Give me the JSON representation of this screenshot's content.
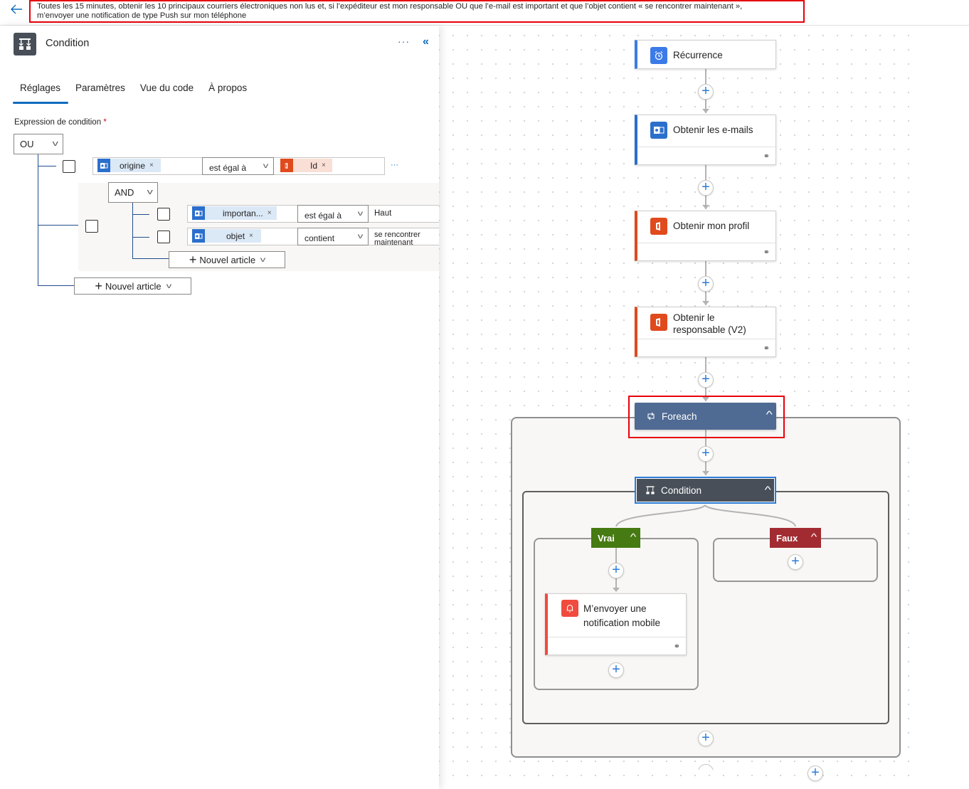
{
  "topbar": {
    "back_icon": "arrow-left-icon",
    "banner_line1": "Toutes les 15 minutes, obtenir les 10 principaux courriers électroniques non lus et, si l’expéditeur est mon responsable OU que l’e-mail est important et que l’objet contient « se rencontrer maintenant »,",
    "banner_line2": "m’envoyer une notification de type Push sur mon téléphone"
  },
  "panel": {
    "title": "Condition",
    "icon": "condition-icon",
    "more_label": "···",
    "collapse_label": "«",
    "tabs": [
      {
        "label": "Réglages",
        "active": true
      },
      {
        "label": "Paramètres",
        "active": false
      },
      {
        "label": "Vue du code",
        "active": false
      },
      {
        "label": "À propos",
        "active": false
      }
    ],
    "expression_label": "Expression de condition",
    "required_mark": "*",
    "root_operator": "OU",
    "rows": [
      {
        "left_token": "origine",
        "left_icon": "outlook-icon",
        "operator": "est égal à",
        "right_token": "Id",
        "right_icon": "office-icon",
        "more": "···"
      }
    ],
    "group": {
      "operator": "AND",
      "rows": [
        {
          "left_token": "importan...",
          "left_icon": "outlook-icon",
          "operator": "est égal à",
          "value": "Haut"
        },
        {
          "left_token": "objet",
          "left_icon": "outlook-icon",
          "operator": "contient",
          "value": "se rencontrer maintenant"
        }
      ],
      "new_item_label": "Nouvel article"
    },
    "new_item_label": "Nouvel article",
    "remove_label": "×"
  },
  "canvas": {
    "nodes": [
      {
        "label": "Récurrence",
        "icon": "alarm-clock-icon",
        "color": "#3b7be8"
      },
      {
        "label": "Obtenir les e-mails",
        "icon": "outlook-icon",
        "color": "#2b6fcc"
      },
      {
        "label": "Obtenir mon profil",
        "icon": "office-icon",
        "color": "#e04a1d"
      },
      {
        "label": "Obtenir le responsable (V2)",
        "icon": "office-icon",
        "color": "#e04a1d"
      }
    ],
    "foreach": {
      "label": "Foreach",
      "icon": "loop-icon",
      "color": "#4f6a93"
    },
    "condition": {
      "label": "Condition",
      "icon": "condition-icon",
      "color": "#484f58"
    },
    "true_branch": {
      "label": "Vrai",
      "color": "#467a12"
    },
    "false_branch": {
      "label": "Faux",
      "color": "#a22b31"
    },
    "notify_node": {
      "label": "M’envoyer une notification mobile",
      "icon": "bell-icon",
      "color": "#f04b3e"
    },
    "add_label": "+",
    "caret_label": "^",
    "link_icon": "link-icon"
  },
  "colors": {
    "accent": "#0f6cbd",
    "highlight": "#e8000b",
    "tree_line": "#1f4e8c"
  }
}
